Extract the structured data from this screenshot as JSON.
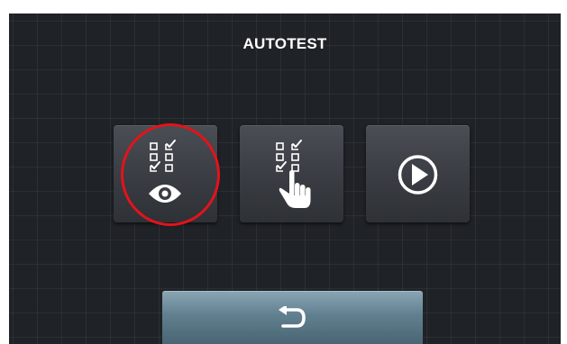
{
  "screen": {
    "title": "AUTOTEST"
  },
  "tiles": [
    {
      "id": "view-test-results",
      "icon": "checklist-eye-icon"
    },
    {
      "id": "manual-test",
      "icon": "checklist-hand-icon"
    },
    {
      "id": "run-autotest",
      "icon": "play-icon"
    }
  ],
  "footer": {
    "back_icon": "return-arrow-icon"
  },
  "colors": {
    "background": "#1f2226",
    "tile": "#3d4046",
    "highlight": "#e3131b",
    "back_button": "#6a8898",
    "text": "#ffffff"
  }
}
